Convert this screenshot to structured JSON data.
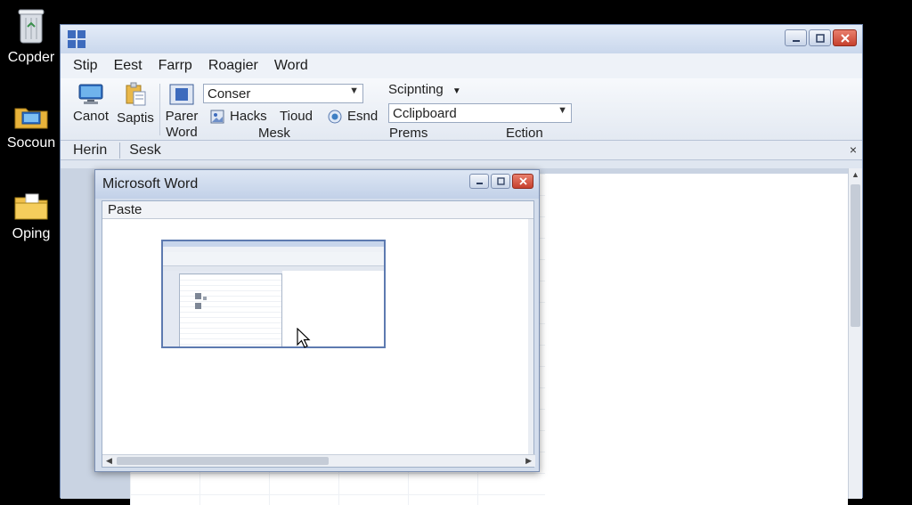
{
  "desktop": {
    "icons": [
      {
        "label": "Copder",
        "icon": "recycle-bin-icon"
      },
      {
        "label": "Socoun",
        "icon": "computer-folder-icon"
      },
      {
        "label": "Oping",
        "icon": "folder-icon"
      }
    ]
  },
  "window": {
    "menu": [
      "Stip",
      "Eest",
      "Farrp",
      "Roagier",
      "Word"
    ],
    "ribbon": {
      "canot_label": "Canot",
      "saptis_label": "Saptis",
      "parer_label": "Parer",
      "word_label": "Word",
      "conser_value": "Conser",
      "hacks_label": "Hacks",
      "tioud_label": "Tioud",
      "esnd_label": "Esnd",
      "mesk_label": "Mesk",
      "scipnting_label": "Scipnting",
      "clipboard_value": "Cclipboard",
      "prems_label": "Prems",
      "ection_label": "Ection"
    },
    "tabs": [
      "Herin",
      "Sesk"
    ],
    "close_glyph": "×"
  },
  "dialog": {
    "title": "Microsoft Word",
    "toolbar_label": "Paste"
  },
  "colors": {
    "accent": "#3d6bbd",
    "close": "#c6402d"
  }
}
